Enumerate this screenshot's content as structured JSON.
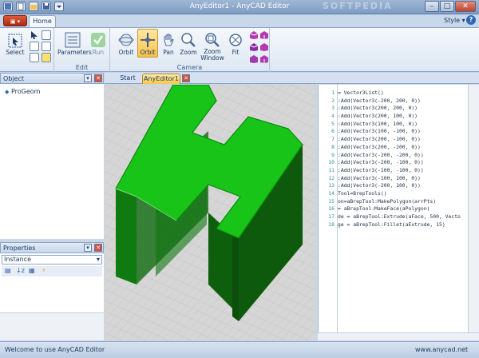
{
  "window": {
    "title": "AnyEditor1 - AnyCAD Editor",
    "watermark": "SOFTPEDIA",
    "min": "–",
    "max": "□",
    "close": "✕"
  },
  "ribbon": {
    "tab_home": "Home",
    "style_label": "Style ▾",
    "help": "?",
    "select_label": "Select",
    "edit_group": "Edit",
    "parameters_label": "Parameters",
    "run_label": "Run",
    "camera_group": "Camera",
    "orbit1_label": "Orbit",
    "orbit2_label": "Orbit",
    "pan_label": "Pan",
    "zoom_label": "Zoom",
    "zoomwindow_label": "Zoom Window",
    "fit_label": "Fit"
  },
  "object_panel": {
    "title": "Object",
    "items": [
      "ProGeom"
    ]
  },
  "properties_panel": {
    "title": "Properties",
    "dropdown": "Instance"
  },
  "doc_tabs": {
    "start": "Start",
    "editor": "AnyEditor1"
  },
  "code": {
    "lines": [
      {
        "n": "1",
        "t": "= Vector3List()"
      },
      {
        "n": "2",
        "t": ":Add(Vector3(-200, 200, 0))"
      },
      {
        "n": "3",
        "t": ":Add(Vector3(200, 200, 0))"
      },
      {
        "n": "4",
        "t": ":Add(Vector3(200, 100, 0))"
      },
      {
        "n": "5",
        "t": ":Add(Vector3(100, 100, 0))"
      },
      {
        "n": "6",
        "t": ":Add(Vector3(100, -100, 0))"
      },
      {
        "n": "7",
        "t": ":Add(Vector3(200, -100, 0))"
      },
      {
        "n": "8",
        "t": ":Add(Vector3(200, -200, 0))"
      },
      {
        "n": "9",
        "t": ":Add(Vector3(-200, -200, 0))"
      },
      {
        "n": "10",
        "t": ":Add(Vector3(-200, -100, 0))"
      },
      {
        "n": "11",
        "t": ":Add(Vector3(-100, -100, 0))"
      },
      {
        "n": "12",
        "t": ":Add(Vector3(-100, 100, 0))"
      },
      {
        "n": "13",
        "t": ":Add(Vector3(-200, 100, 0))"
      },
      {
        "n": "14",
        "t": "Tool=BrepTools()"
      },
      {
        "n": "15",
        "t": "on=aBrepTool:MakePolygon(arrPts)"
      },
      {
        "n": "16",
        "t": "= aBrepTool:MakeFace(aPolygon)"
      },
      {
        "n": "17",
        "t": "de = aBrepTool:Extrude(aFace, 500, Vecto"
      },
      {
        "n": "18",
        "t": "ge = aBrepTool:Fillet(aExtrude, 15)"
      }
    ]
  },
  "status": {
    "left": "Welcome to use AnyCAD Editor",
    "right": "www.anycad.net"
  },
  "colors": {
    "model_green": "#18c418",
    "accent": "#f5c84c"
  }
}
